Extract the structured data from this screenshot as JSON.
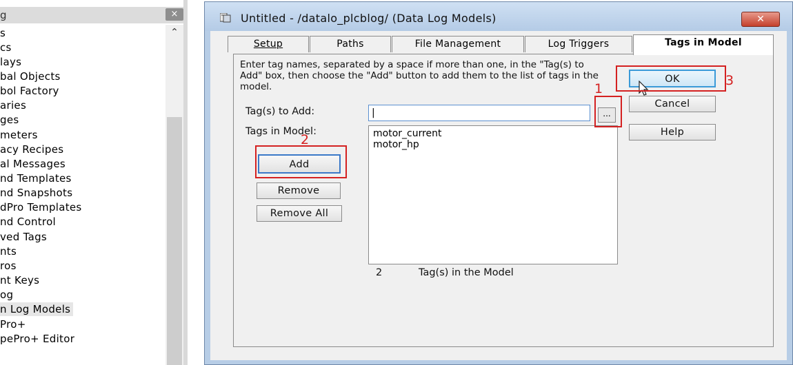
{
  "explorer": {
    "header_title": "g",
    "close_label": "×",
    "scroll_up": "⌃",
    "items": [
      {
        "label": "s"
      },
      {
        "label": "cs"
      },
      {
        "label": "lays"
      },
      {
        "label": "bal Objects"
      },
      {
        "label": "bol Factory"
      },
      {
        "label": "aries"
      },
      {
        "label": "ges"
      },
      {
        "label": "meters"
      },
      {
        "label": "acy Recipes"
      },
      {
        "label": "al Messages"
      },
      {
        "label": "nd Templates"
      },
      {
        "label": "nd Snapshots"
      },
      {
        "label": "dPro Templates"
      },
      {
        "label": "nd Control"
      },
      {
        "label": "ved Tags"
      },
      {
        "label": "nts"
      },
      {
        "label": "ros"
      },
      {
        "label": "nt Keys"
      },
      {
        "label": "og"
      },
      {
        "label": "n Log Models",
        "selected": true
      },
      {
        "label": "Pro+"
      },
      {
        "label": "pePro+ Editor"
      }
    ]
  },
  "dialog": {
    "title": "Untitled - /datalo_plcblog/ (Data Log Models)",
    "close_label": "✕",
    "tabs": [
      {
        "label": "Setup",
        "active": false
      },
      {
        "label": "Paths",
        "active": false
      },
      {
        "label": "File Management",
        "active": false
      },
      {
        "label": "Log Triggers",
        "active": false
      },
      {
        "label": "Tags in Model",
        "active": true
      }
    ],
    "instructions": "Enter tag names, separated by a space if more than one, in the \"Tag(s) to Add\" box, then choose the \"Add\"  button to add them to the list of tags in the model.",
    "tags_to_add_label": "Tag(s) to Add:",
    "tags_to_add_value": "|",
    "browse_label": "...",
    "tags_in_model_label": "Tags in Model:",
    "tags_in_model": [
      "motor_current",
      "motor_hp"
    ],
    "tag_count": "2",
    "tag_count_label": "Tag(s) in the Model",
    "buttons": {
      "add": "Add",
      "remove": "Remove",
      "remove_all": "Remove All",
      "ok": "OK",
      "cancel": "Cancel",
      "help": "Help"
    }
  },
  "annotations": {
    "step1": "1",
    "step2": "2",
    "step3": "3",
    "color": "#d42020"
  }
}
